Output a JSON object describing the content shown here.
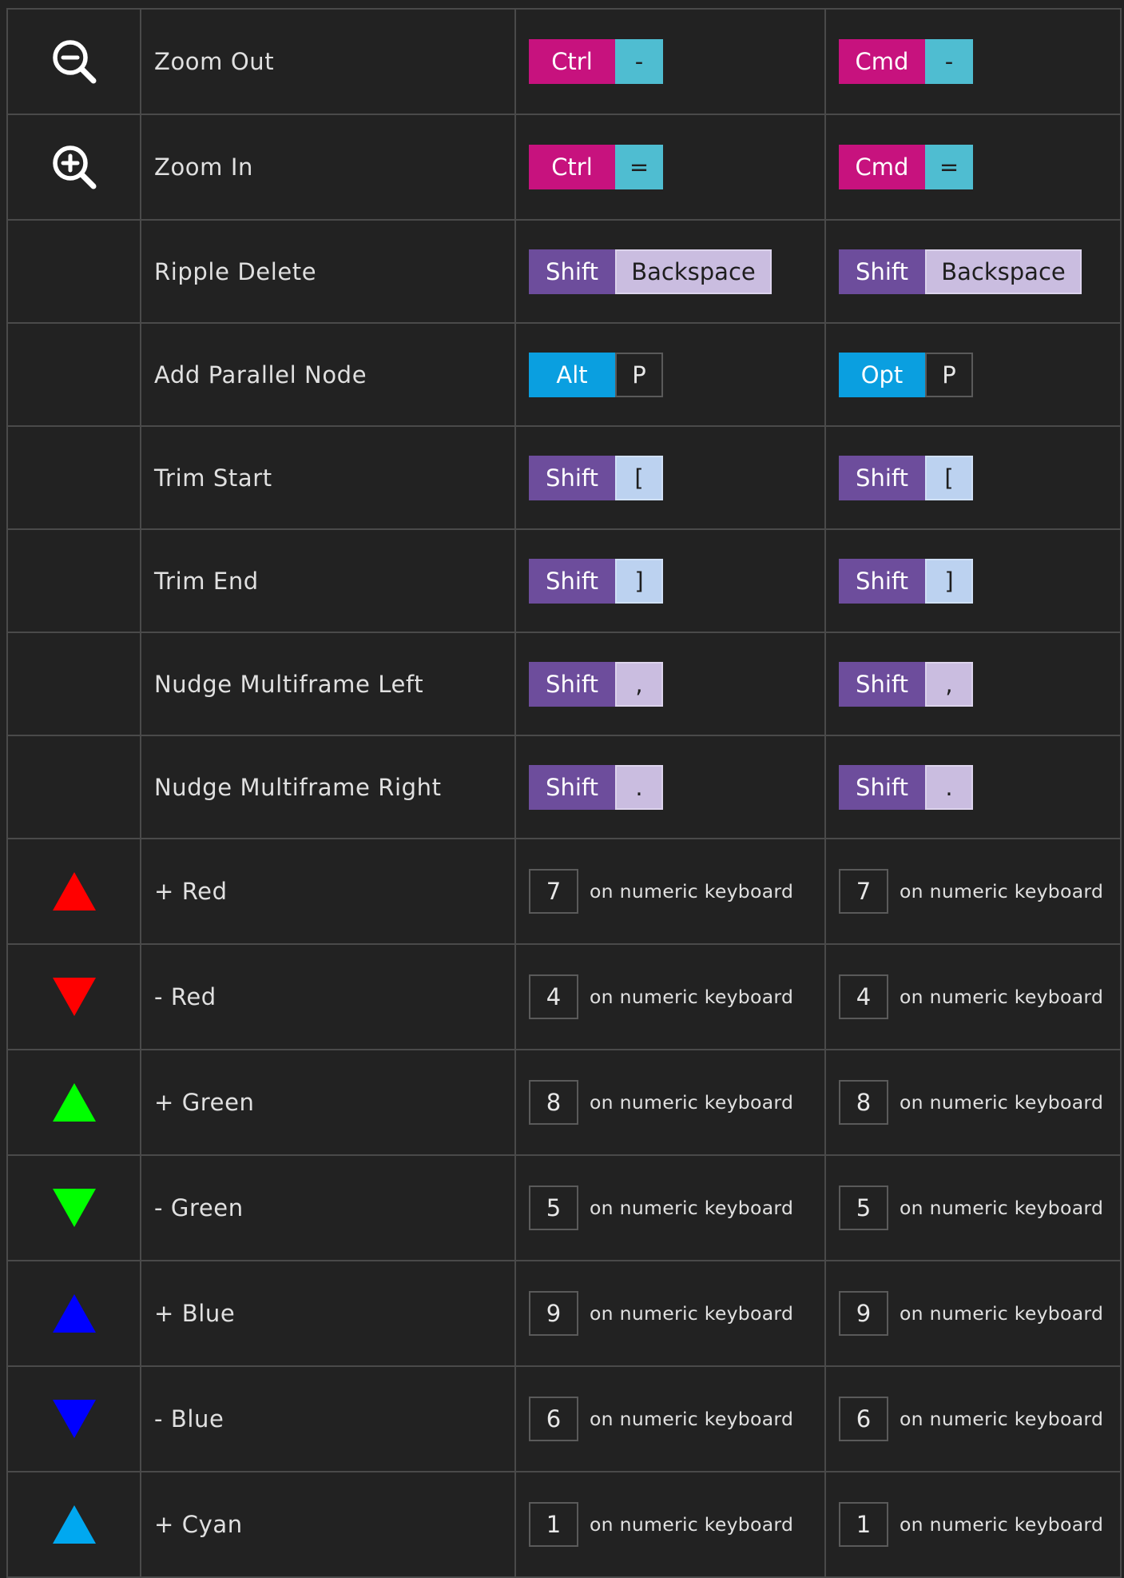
{
  "rows": [
    {
      "label": "Zoom Out",
      "icon": "zoom-out-icon",
      "win": {
        "mod": "Ctrl",
        "key": "-"
      },
      "mac": {
        "mod": "Cmd",
        "key": "-"
      }
    },
    {
      "label": "Zoom In",
      "icon": "zoom-in-icon",
      "win": {
        "mod": "Ctrl",
        "key": "="
      },
      "mac": {
        "mod": "Cmd",
        "key": "="
      }
    },
    {
      "label": "Ripple Delete",
      "win": {
        "mod": "Shift",
        "key": "Backspace"
      },
      "mac": {
        "mod": "Shift",
        "key": "Backspace"
      }
    },
    {
      "label": "Add Parallel Node",
      "win": {
        "mod": "Alt",
        "key": "P"
      },
      "mac": {
        "mod": "Opt",
        "key": "P"
      }
    },
    {
      "label": "Trim Start",
      "win": {
        "mod": "Shift",
        "key": "["
      },
      "mac": {
        "mod": "Shift",
        "key": "["
      }
    },
    {
      "label": "Trim End",
      "win": {
        "mod": "Shift",
        "key": "]"
      },
      "mac": {
        "mod": "Shift",
        "key": "]"
      }
    },
    {
      "label": "Nudge Multiframe Left",
      "win": {
        "mod": "Shift",
        "key": ","
      },
      "mac": {
        "mod": "Shift",
        "key": ","
      }
    },
    {
      "label": "Nudge Multiframe Right",
      "win": {
        "mod": "Shift",
        "key": "."
      },
      "mac": {
        "mod": "Shift",
        "key": "."
      }
    },
    {
      "label": "+ Red",
      "icon": "triangle-up-red-icon",
      "color": "#ff0000",
      "numkey": "7"
    },
    {
      "label": "- Red",
      "icon": "triangle-down-red-icon",
      "color": "#ff0000",
      "numkey": "4"
    },
    {
      "label": "+ Green",
      "icon": "triangle-up-green-icon",
      "color": "#00ff00",
      "numkey": "8"
    },
    {
      "label": "- Green",
      "icon": "triangle-down-green-icon",
      "color": "#00ff00",
      "numkey": "5"
    },
    {
      "label": "+ Blue",
      "icon": "triangle-up-blue-icon",
      "color": "#0000ff",
      "numkey": "9"
    },
    {
      "label": "- Blue",
      "icon": "triangle-down-blue-icon",
      "color": "#0000ff",
      "numkey": "6"
    },
    {
      "label": "+ Cyan",
      "icon": "triangle-up-cyan-icon",
      "color": "#00a8f0",
      "numkey": "1"
    }
  ],
  "numeric_suffix": "on numeric keyboard",
  "colors": {
    "background": "#222222",
    "ctrl_cmd": "#c7127e",
    "shift": "#6d4d9c",
    "alt_opt": "#0a9fe0",
    "minus_equals": "#4fbdd1",
    "backspace_comma_period": "#cabde0",
    "brackets": "#bcd2f0"
  }
}
